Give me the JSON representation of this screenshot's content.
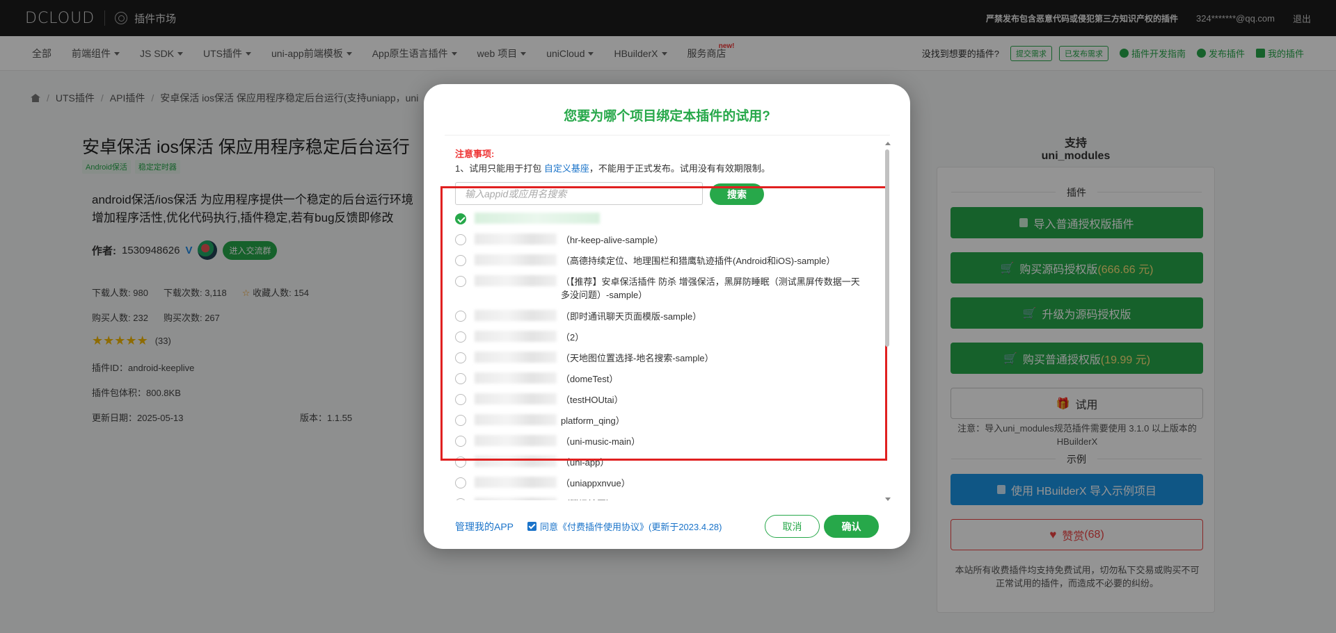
{
  "topbar": {
    "logo": "DCLOUD",
    "market": "插件市场",
    "warning": "严禁发布包含恶意代码或侵犯第三方知识产权的插件",
    "user": "324*******@qq.com",
    "logout": "退出"
  },
  "nav": {
    "items": [
      {
        "label": "全部",
        "caret": false
      },
      {
        "label": "前端组件",
        "caret": true
      },
      {
        "label": "JS SDK",
        "caret": true
      },
      {
        "label": "UTS插件",
        "caret": true
      },
      {
        "label": "uni-app前端模板",
        "caret": true
      },
      {
        "label": "App原生语言插件",
        "caret": true
      },
      {
        "label": "web 项目",
        "caret": true
      },
      {
        "label": "uniCloud",
        "caret": true
      },
      {
        "label": "HBuilderX",
        "caret": true
      },
      {
        "label": "服务商店",
        "caret": false,
        "badge": "new!"
      }
    ],
    "not_found": "没找到想要的插件?",
    "submit_request": "提交需求",
    "published_request": "已发布需求",
    "dev_guide": "插件开发指南",
    "publish_plugin": "发布插件",
    "my_plugins": "我的插件"
  },
  "breadcrumb": [
    "UTS插件",
    "API插件",
    "安卓保活 ios保活 保应用程序稳定后台运行(支持uniapp，uni"
  ],
  "plugin": {
    "title": "安卓保活 ios保活 保应用程序稳定后台运行",
    "tags": [
      "Android保活",
      "稳定定时器"
    ],
    "desc_line1": "android保活/ios保活 为应用程序提供一个稳定的后台运行环境",
    "desc_line2": "增加程序活性,优化代码执行,插件稳定,若有bug反馈即修改",
    "author_label": "作者:",
    "author_id": "1530948626",
    "verified": "V",
    "join_group": "进入交流群",
    "stats_row1": [
      {
        "label": "下载人数:",
        "value": "980"
      },
      {
        "label": "下载次数:",
        "value": "3,118"
      },
      {
        "label": "收藏人数:",
        "value": "154"
      }
    ],
    "stats_row2": [
      {
        "label": "购买人数:",
        "value": "232"
      },
      {
        "label": "购买次数:",
        "value": "267"
      }
    ],
    "rating_stars": 5,
    "rating_count": "(33)",
    "plugin_id": "插件ID：android-keeplive",
    "package_size": "插件包体积：800.8KB",
    "update_date": "更新日期：2025-05-13",
    "version": "版本：1.1.55"
  },
  "side": {
    "support_tab": "支持uni_modules",
    "section_plugin": "插件",
    "import_btn": "导入普通授权版插件",
    "buy_source_label": "购买源码授权版",
    "buy_source_price": "(666.66 元)",
    "upgrade_btn": "升级为源码授权版",
    "buy_normal_label": "购买普通授权版",
    "buy_normal_price": "(19.99 元)",
    "trial_btn": "试用",
    "note": "注意：导入uni_modules规范插件需要使用 3.1.0 以上版本的 HBuilderX",
    "section_example": "示例",
    "example_btn": "使用 HBuilderX 导入示例项目",
    "reward_btn": "赞赏",
    "reward_count": "(68)",
    "footer_note": "本站所有收费插件均支持免费试用，切勿私下交易或购买不可正常试用的插件，而造成不必要的纠纷。"
  },
  "modal": {
    "title": "您要为哪个项目绑定本插件的试用?",
    "notice_head": "注意事项:",
    "notice_prefix": "1、试用只能用于打包",
    "notice_link": "自定义基座",
    "notice_suffix": "，不能用于正式发布。试用没有有效期限制。",
    "search_placeholder": "输入appid或应用名搜索",
    "search_btn": "搜索",
    "apps": [
      {
        "text": "",
        "checked": true
      },
      {
        "text": "（hr-keep-alive-sample）",
        "checked": false
      },
      {
        "text": "（高德持续定位、地理围栏和猎鹰轨迹插件(Android和iOS)-sample）",
        "checked": false
      },
      {
        "text": "（【推荐】安卓保活插件 防杀 增强保活，黑屏防睡眠（测试黑屏传数据一天多没问题）-sample）",
        "checked": false
      },
      {
        "text": "（即时通讯聊天页面模版-sample）",
        "checked": false
      },
      {
        "text": "（2）",
        "checked": false
      },
      {
        "text": "（天地图位置选择-地名搜索-sample）",
        "checked": false
      },
      {
        "text": "（domeTest）",
        "checked": false
      },
      {
        "text": "（testHOUtai）",
        "checked": false
      },
      {
        "text": "platform_qing）",
        "checked": false
      },
      {
        "text": "（uni-music-main）",
        "checked": false
      },
      {
        "text": "（uni-app）",
        "checked": false
      },
      {
        "text": "（uniappxnvue）",
        "checked": false
      },
      {
        "text": "（腾讯地图）",
        "checked": false
      }
    ],
    "manage_link": "管理我的APP",
    "agree_text": "同意《付费插件使用协议》(更新于2023.4.28)",
    "cancel_btn": "取消",
    "ok_btn": "确认"
  }
}
